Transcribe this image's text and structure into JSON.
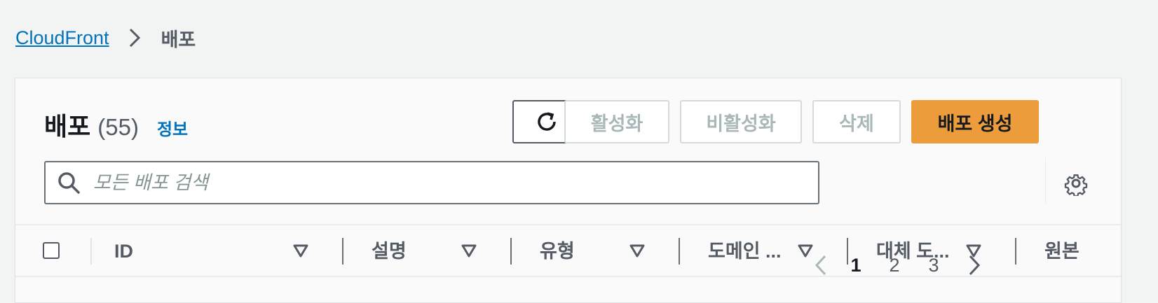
{
  "breadcrumb": {
    "root": "CloudFront",
    "current": "배포"
  },
  "header": {
    "title": "배포",
    "count": "(55)",
    "info_link": "정보"
  },
  "toolbar": {
    "refresh_icon": "refresh-icon",
    "enable_label": "활성화",
    "disable_label": "비활성화",
    "delete_label": "삭제",
    "create_label": "배포 생성"
  },
  "search": {
    "placeholder": "모든 배포 검색",
    "value": ""
  },
  "pagination": {
    "pages": [
      "1",
      "2",
      "3"
    ],
    "current": "1"
  },
  "table": {
    "columns": [
      {
        "label": "ID"
      },
      {
        "label": "설명"
      },
      {
        "label": "유형"
      },
      {
        "label": "도메인 ..."
      },
      {
        "label": "대체 도..."
      },
      {
        "label": "원본"
      }
    ]
  },
  "colors": {
    "accent": "#ec9c3a",
    "link": "#0073bb",
    "text": "#16191f",
    "muted": "#545b64",
    "disabled": "#aab7b8"
  }
}
